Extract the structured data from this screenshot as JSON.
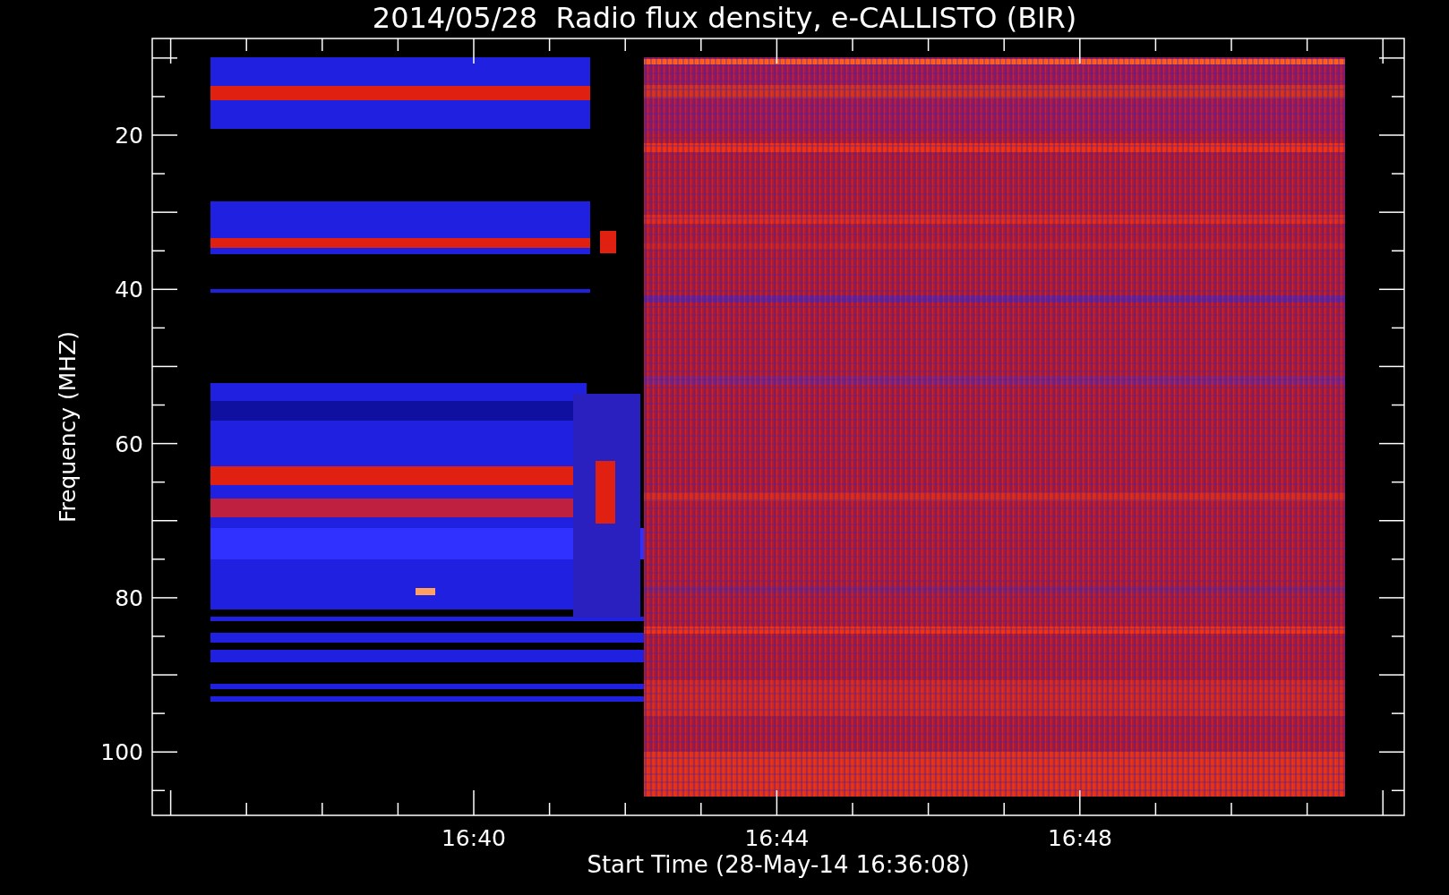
{
  "title": "2014/05/28  Radio flux density, e-CALLISTO (BIR)",
  "y_axis": {
    "label": "Frequency (MHZ)",
    "ticks": [
      "20",
      "40",
      "60",
      "80",
      "100"
    ]
  },
  "x_axis": {
    "label": "Start Time (28-May-14 16:36:08)",
    "ticks": [
      "16:40",
      "16:44",
      "16:48"
    ]
  }
}
